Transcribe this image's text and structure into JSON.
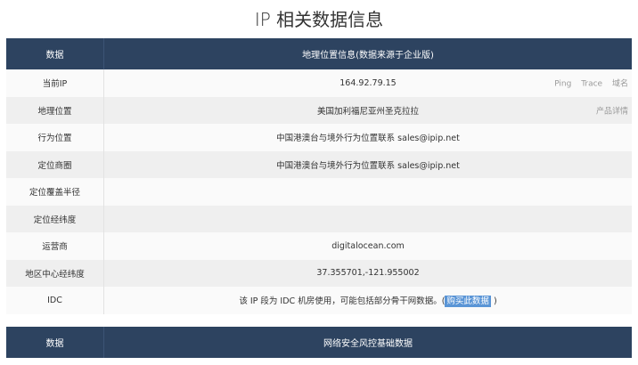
{
  "title": "IP 相关数据信息",
  "table1": {
    "header": [
      "数据",
      "地理位置信息(数据来源于企业版)"
    ],
    "rows": [
      {
        "label": "当前IP",
        "value": "164.92.79.15"
      },
      {
        "label": "地理位置",
        "value": "美国加利福尼亚州圣克拉拉"
      },
      {
        "label": "行为位置",
        "value": "中国港澳台与境外行为位置联系 sales@ipip.net"
      },
      {
        "label": "定位商圈",
        "value": "中国港澳台与境外行为位置联系 sales@ipip.net"
      },
      {
        "label": "定位覆盖半径",
        "value": ""
      },
      {
        "label": "定位经纬度",
        "value": ""
      },
      {
        "label": "运营商",
        "value": "digitalocean.com"
      },
      {
        "label": "地区中心经纬度",
        "value": "37.355701,-121.955002"
      },
      {
        "label": "IDC",
        "value": "该 IP 段为 IDC 机房使用，可能包括部分骨干网数据。(",
        "link": "购买此数据",
        "suffix": " )"
      }
    ],
    "ip_links": [
      "Ping",
      "Trace",
      "域名"
    ],
    "geo_link": "产品详情"
  },
  "table2": {
    "header": [
      "数据",
      "网络安全风控基础数据"
    ]
  }
}
